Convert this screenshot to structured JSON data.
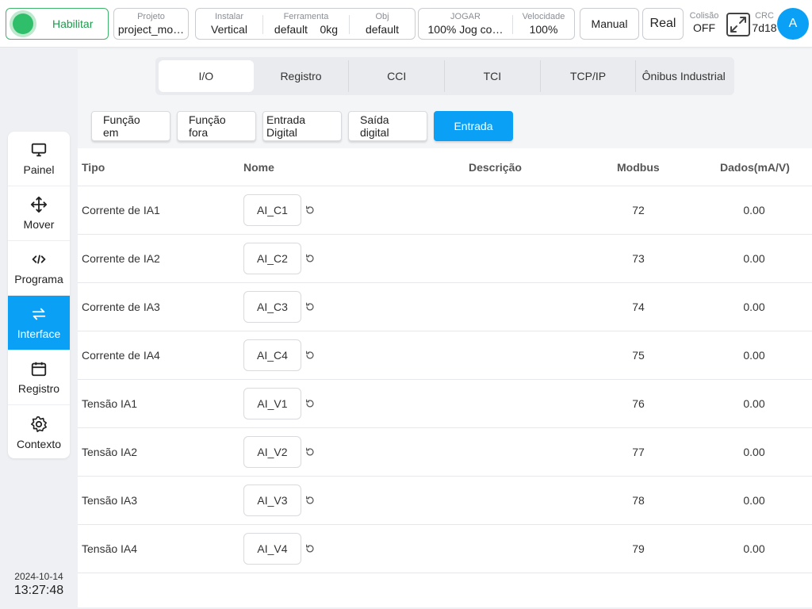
{
  "topbar": {
    "enable_label": "Habilitar",
    "projeto_key": "Projeto",
    "projeto_val": "project_mo…",
    "instalar_key": "Instalar",
    "instalar_val": "Vertical",
    "ferramenta_key": "Ferramenta",
    "ferramenta_val": "default",
    "ferramenta_weight": "0kg",
    "obj_key": "Obj",
    "obj_val": "default",
    "jogar_key": "JOGAR",
    "jogar_val": "100%  Jog co…",
    "velocidade_key": "Velocidade",
    "velocidade_val": "100%",
    "manual_label": "Manual",
    "real_label": "Real",
    "colisao_key": "Colisão",
    "colisao_val": "OFF",
    "crc_key": "CRC",
    "crc_val": "7d18",
    "avatar_letter": "A"
  },
  "sidebar": {
    "items": [
      {
        "label": "Painel",
        "icon": "monitor-icon"
      },
      {
        "label": "Mover",
        "icon": "move-arrows-icon"
      },
      {
        "label": "Programa",
        "icon": "code-icon"
      },
      {
        "label": "Interface",
        "icon": "swap-arrows-icon"
      },
      {
        "label": "Registro",
        "icon": "calendar-icon"
      },
      {
        "label": "Contexto",
        "icon": "gear-icon"
      }
    ],
    "active": "Interface",
    "date": "2024-10-14",
    "time": "13:27:48"
  },
  "tabs": [
    "I/O",
    "Registro",
    "CCI",
    "TCI",
    "TCP/IP",
    "Ônibus Industrial"
  ],
  "active_tab": "I/O",
  "subtabs": [
    "Função em",
    "Função fora",
    "Entrada Digital",
    "Saída digital",
    "Entrada"
  ],
  "active_subtab": "Entrada",
  "table": {
    "headers": {
      "tipo": "Tipo",
      "nome": "Nome",
      "descricao": "Descrição",
      "modbus": "Modbus",
      "dados": "Dados(mA/V)"
    },
    "rows": [
      {
        "tipo": "Corrente de IA1",
        "nome": "AI_C1",
        "descricao": "",
        "modbus": "72",
        "dados": "0.00"
      },
      {
        "tipo": "Corrente de IA2",
        "nome": "AI_C2",
        "descricao": "",
        "modbus": "73",
        "dados": "0.00"
      },
      {
        "tipo": "Corrente de IA3",
        "nome": "AI_C3",
        "descricao": "",
        "modbus": "74",
        "dados": "0.00"
      },
      {
        "tipo": "Corrente de IA4",
        "nome": "AI_C4",
        "descricao": "",
        "modbus": "75",
        "dados": "0.00"
      },
      {
        "tipo": "Tensão IA1",
        "nome": "AI_V1",
        "descricao": "",
        "modbus": "76",
        "dados": "0.00"
      },
      {
        "tipo": "Tensão IA2",
        "nome": "AI_V2",
        "descricao": "",
        "modbus": "77",
        "dados": "0.00"
      },
      {
        "tipo": "Tensão IA3",
        "nome": "AI_V3",
        "descricao": "",
        "modbus": "78",
        "dados": "0.00"
      },
      {
        "tipo": "Tensão IA4",
        "nome": "AI_V4",
        "descricao": "",
        "modbus": "79",
        "dados": "0.00"
      }
    ]
  },
  "colors": {
    "accent": "#0aa0f5",
    "enable_green": "#2fbf6a"
  }
}
